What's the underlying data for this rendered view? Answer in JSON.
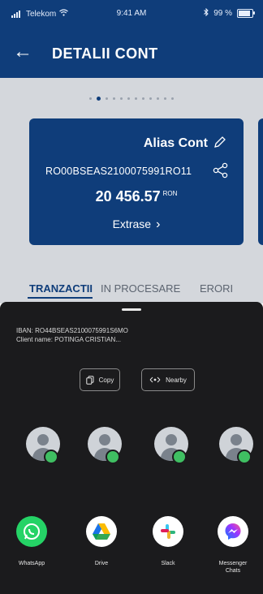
{
  "status_bar": {
    "carrier": "Telekom",
    "time": "9:41 AM",
    "battery": "99 %"
  },
  "header": {
    "title": "DETALII CONT"
  },
  "pager": {
    "count": 12,
    "active_index": 1
  },
  "account_card": {
    "alias": "Alias Cont",
    "iban": "RO00BSEAS2100075991RO11",
    "amount": "20 456.57",
    "currency": "RON",
    "statements_label": "Extrase"
  },
  "tabs": [
    {
      "label": "TRANZACTII",
      "active": true
    },
    {
      "label": "IN PROCESARE",
      "active": false
    },
    {
      "label": "ERORI",
      "active": false
    }
  ],
  "share_sheet": {
    "shared_lines": [
      "IBAN: RO44BSEAS2100075991S6MO",
      "Client name: POTINGA CRISTIAN..."
    ],
    "actions": [
      {
        "label": "Copy",
        "icon": "copy-icon"
      },
      {
        "label": "Nearby",
        "icon": "nearby-icon"
      }
    ],
    "apps": [
      {
        "label": "WhatsApp",
        "icon": "whatsapp-icon"
      },
      {
        "label": "Drive",
        "icon": "drive-icon"
      },
      {
        "label": "Slack",
        "icon": "slack-icon"
      },
      {
        "label": "Messenger",
        "sub": "Chats",
        "icon": "messenger-icon"
      }
    ]
  },
  "colors": {
    "brand_blue": "#0f3d7a",
    "sheet_bg": "#1b1b1d",
    "badge_green": "#3fbf62"
  }
}
